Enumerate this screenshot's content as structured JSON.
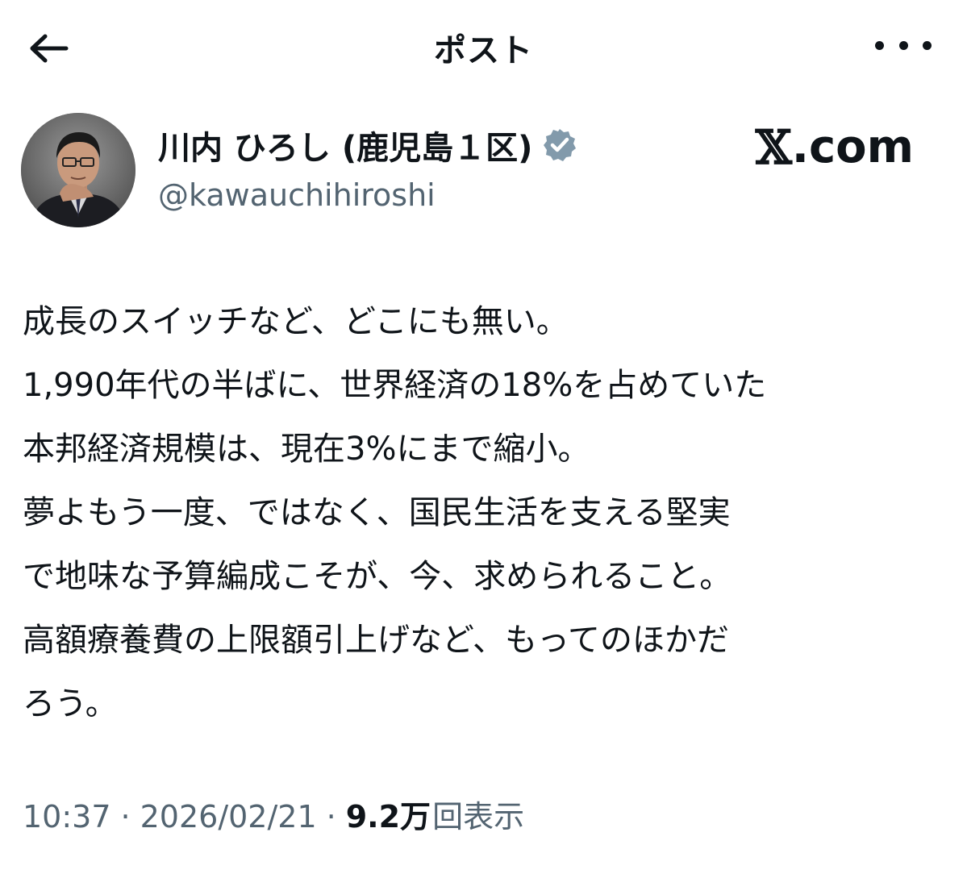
{
  "header": {
    "title": "ポスト",
    "back_icon": "arrow-left-icon",
    "more_icon": "more-horizontal-icon"
  },
  "author": {
    "name": "川内 ひろし (鹿児島１区)",
    "handle": "@kawauchihiroshi",
    "verified": true,
    "verified_color": "#829aab"
  },
  "brand": {
    "x_mark": "𝕏",
    "domain": ".com"
  },
  "post": {
    "lines": [
      "成長のスイッチなど、どこにも無い。",
      "1,990年代の半ばに、世界経済の18%を占めていた",
      "本邦経済規模は、現在3%にまで縮小。",
      "夢よもう一度、ではなく、国民生活を支える堅実",
      "で地味な予算編成こそが、今、求められること。",
      "高額療養費の上限額引上げなど、もってのほかだ",
      "ろう。"
    ]
  },
  "meta": {
    "time": "10:37",
    "separator": "·",
    "date": "2026/02/21",
    "views_count": "9.2万",
    "views_label": "回表示"
  },
  "colors": {
    "text": "#0f1419",
    "secondary": "#536471",
    "background": "#ffffff"
  }
}
